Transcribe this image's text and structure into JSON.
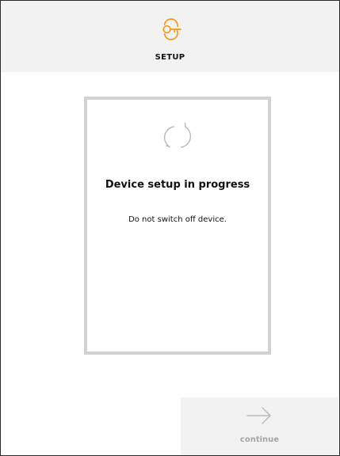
{
  "colors": {
    "accent": "#f39a1e",
    "header_bg": "#f2f2f2",
    "card_border": "#d2d2d2",
    "disabled_text": "#a4a4a4",
    "icon_gray": "#b9b9b9"
  },
  "header": {
    "icon": "key-icon",
    "title": "SETUP"
  },
  "status_card": {
    "icon": "refresh-icon",
    "title": "Device setup in progress",
    "subtitle": "Do not switch off device."
  },
  "footer": {
    "continue_icon": "arrow-right-icon",
    "continue_label": "continue",
    "continue_enabled": false
  }
}
